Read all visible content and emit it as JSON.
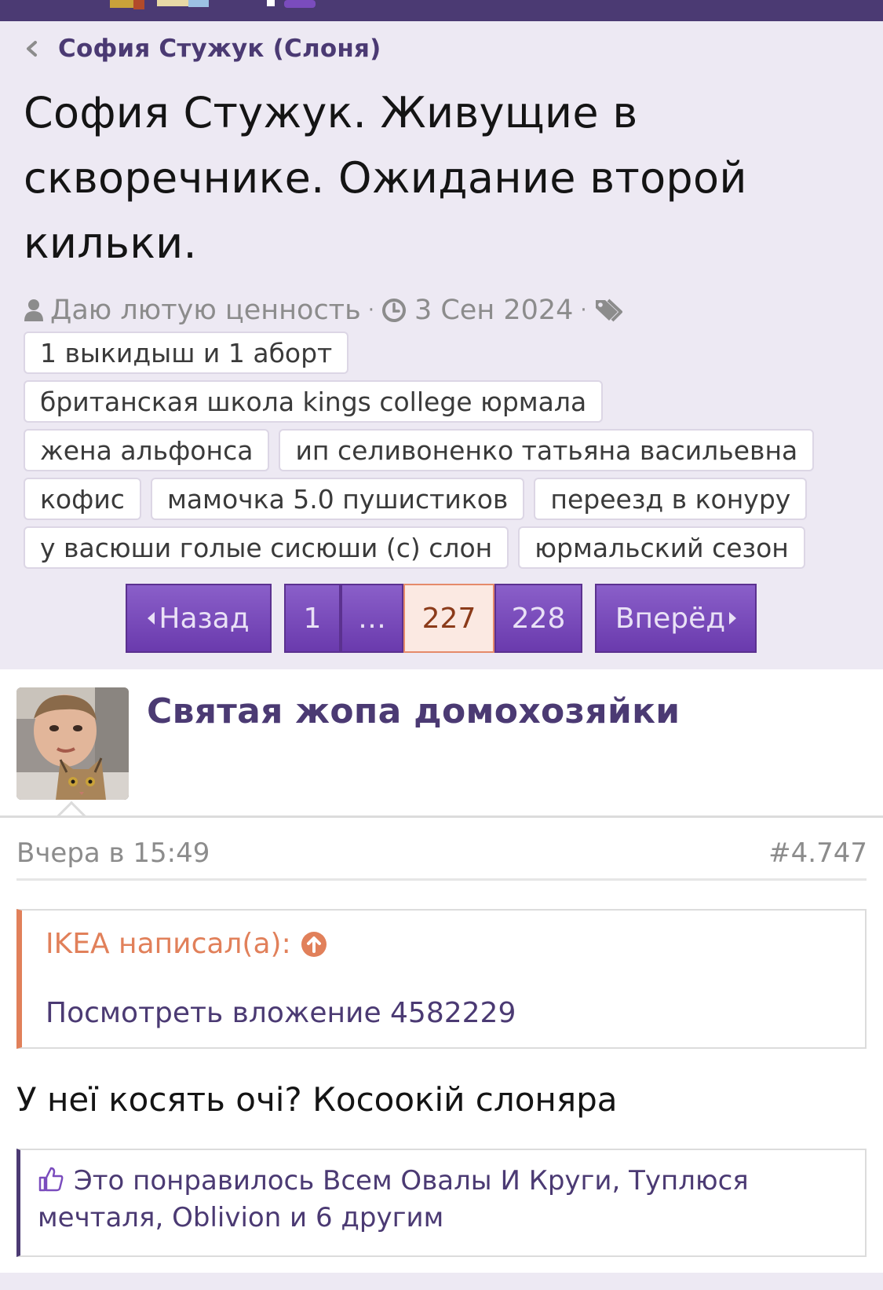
{
  "breadcrumb": {
    "label": "София Стужук (Слоня)"
  },
  "thread": {
    "title": "София Стужук. Живущие в скворечнике. Ожидание второй кильки.",
    "author": "Даю лютую ценность",
    "date": "3 Сен 2024",
    "tags": [
      "1 выкидыш и 1 аборт",
      "британская школа kings college юрмала",
      "жена альфонса",
      "ип селивоненко татьяна васильевна",
      "кофис",
      "мамочка 5.0 пушистиков",
      "переезд в конуру",
      "у васюши голые сисюши (с) слон",
      "юрмальский сезон"
    ]
  },
  "pager": {
    "prev_label": "Назад",
    "next_label": "Вперёд",
    "pages": [
      "1",
      "…",
      "227",
      "228"
    ],
    "current": "227"
  },
  "post": {
    "author": "Святая жопа домохозяйки",
    "time": "Вчера в 15:49",
    "number": "#4.747",
    "quote": {
      "header": "IKEA написал(а):",
      "link": "Посмотреть вложение 4582229"
    },
    "text": "У неї косять очі? Косоокій слоняра",
    "likes_text": "Это понравилось Всем Овалы И Круги, Туплюся мечталя, Oblivion и 6 другим"
  },
  "colors": {
    "brand": "#4b3a73",
    "pager_button": "#7a4cbd",
    "current_page_bg": "#fbe9e2",
    "quote_accent": "#e1805a",
    "meta_gray": "#8c8c8c"
  },
  "icons": [
    "chevron-left-icon",
    "user-icon",
    "clock-icon",
    "tags-icon",
    "arrow-up-circle-icon",
    "thumbs-up-icon"
  ]
}
